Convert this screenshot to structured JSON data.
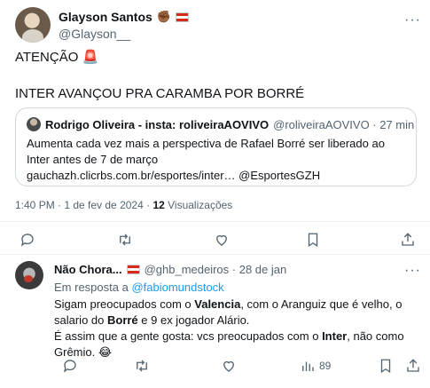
{
  "post": {
    "display_name": "Glayson Santos",
    "name_emoji": "✊🏾",
    "handle": "@Glayson__",
    "text_line1": "ATENÇÃO 🚨",
    "text_line2": "INTER AVANÇOU PRA CARAMBA POR BORRÉ",
    "quote": {
      "author": "Rodrigo Oliveira - insta: roliveiraAOVIVO",
      "handle_time": "@roliveiraAOVIVO · 27 min",
      "text": "Aumenta cada vez mais a perspectiva de Rafael Borré ser liberado ao Inter antes de 7 de março",
      "link": "gauchazh.clicrbs.com.br/esportes/inter… @EsportesGZH"
    },
    "timestamp": "1:40 PM · 1 de fev de 2024 · ",
    "views_count": "12",
    "views_label": " Visualizações"
  },
  "reply": {
    "display_name": "Não Chora...",
    "handle_time": "@ghb_medeiros · 28 de jan",
    "replying_prefix": "Em resposta a ",
    "replying_to": "@fabiomundstock",
    "body": {
      "p1_a": "Sigam preocupados com o ",
      "p1_b": "Valencia",
      "p1_c": ", com o Aranguiz que é velho, o salario do ",
      "p1_d": "Borré",
      "p1_e": " e 9 ex jogador Alário.",
      "p2_a": "É assim que a gente gosta: vcs preocupados com o ",
      "p2_b": "Inter",
      "p2_c": ", não como Grêmio. 😂"
    },
    "views": "89"
  },
  "icons": {
    "more": "more-icon",
    "reply": "reply-icon",
    "retweet": "retweet-icon",
    "like": "like-icon",
    "bookmark": "bookmark-icon",
    "share": "share-icon",
    "views": "views-icon"
  },
  "colors": {
    "link": "#1d9bf0",
    "muted": "#536471",
    "border": "#cfd9de"
  }
}
